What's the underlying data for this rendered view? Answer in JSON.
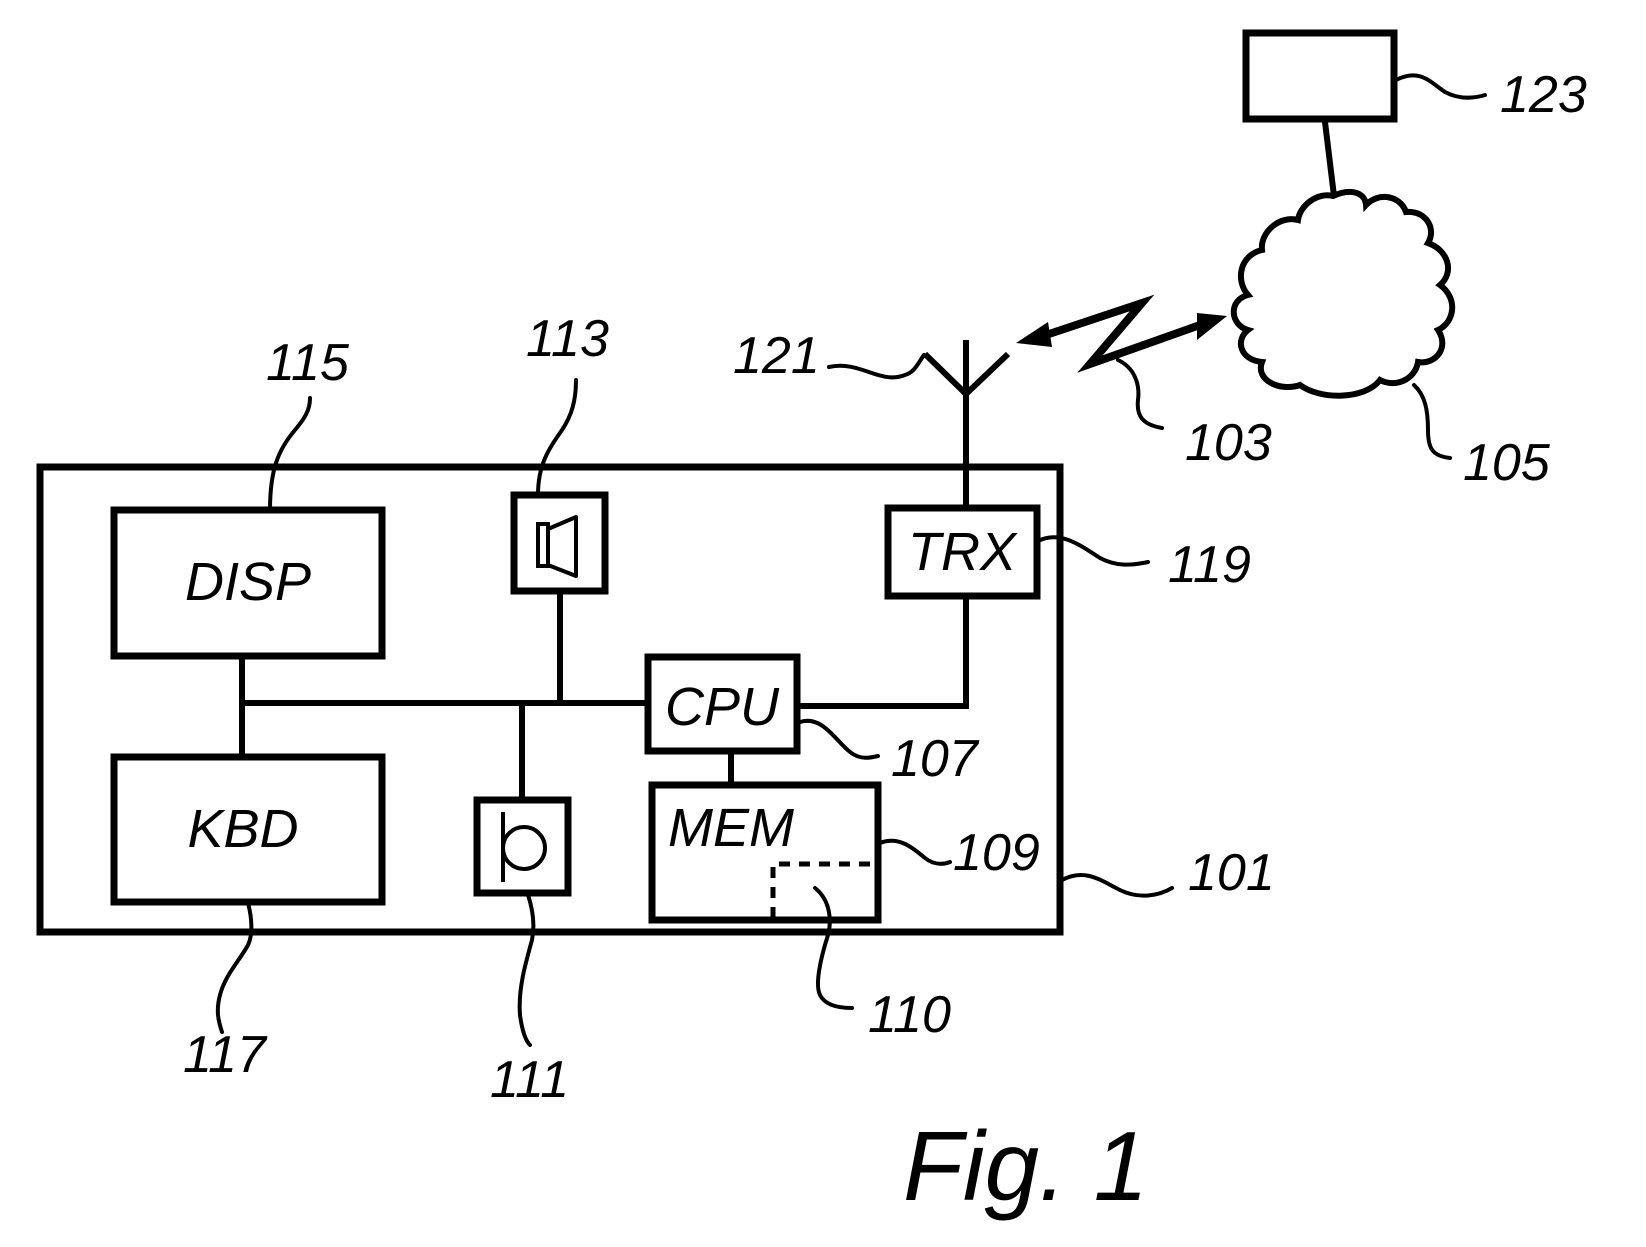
{
  "figure": {
    "caption": "Fig. 1",
    "blocks": {
      "display": "DISP",
      "keyboard": "KBD",
      "cpu": "CPU",
      "memory": "MEM",
      "transceiver": "TRX"
    },
    "icons": {
      "speaker": "speaker-icon",
      "microphone": "microphone-icon",
      "antenna": "antenna-icon",
      "network_cloud": "cloud-icon",
      "wireless_link": "lightning-arrow-icon"
    },
    "reference_numerals": {
      "terminal": "101",
      "wireless_link": "103",
      "network": "105",
      "cpu": "107",
      "memory": "109",
      "memory_region": "110",
      "microphone": "111",
      "speaker": "113",
      "display": "115",
      "keyboard": "117",
      "transceiver": "119",
      "antenna": "121",
      "server": "123"
    }
  }
}
